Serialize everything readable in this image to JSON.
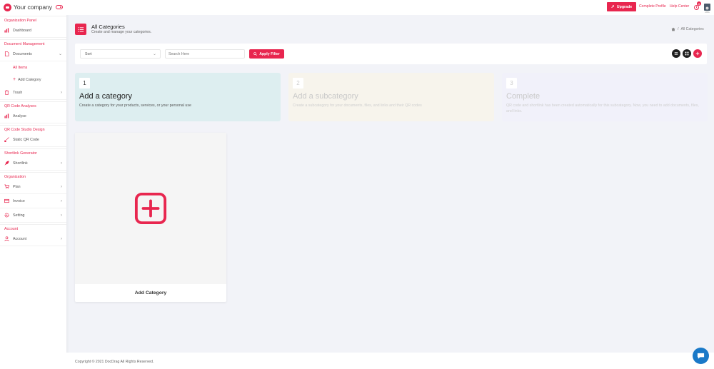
{
  "brand": {
    "name": "Your company"
  },
  "sidebar": {
    "sections": {
      "org_panel": "Organization Panel",
      "doc_mgmt": "Document Management",
      "qr_analyses": "QR Code Analyses",
      "qr_studio": "QR Code Studio Design",
      "shortlink_gen": "Shortlink Generator",
      "organization": "Organization",
      "account": "Account"
    },
    "items": {
      "dashboard": "Dashboard",
      "documents": "Documents",
      "all_items": "All Items",
      "add_category": "Add Category",
      "trash": "Trash",
      "analyse": "Analyse",
      "static_qr": "Static QR Code",
      "shortlink": "Shortlink",
      "plan": "Plan",
      "invoice": "Invoice",
      "setting": "Setting",
      "account": "Account"
    }
  },
  "header": {
    "upgrade_label": "Upgrade",
    "complete_profile": "Complete Profile",
    "help_center": "Help Center",
    "notification_count": "8"
  },
  "page": {
    "title": "All Categories",
    "subtitle": "Create and manage your categories.",
    "breadcrumb_current": "All Categories",
    "breadcrumb_sep": "/"
  },
  "filter": {
    "sort_label": "Sort",
    "search_placeholder": "Search Here",
    "apply_label": "Apply Filter"
  },
  "steps": [
    {
      "num": "1",
      "title": "Add a category",
      "desc": "Create a category for your products, services, or your personal use"
    },
    {
      "num": "2",
      "title": "Add a subcategory",
      "desc": "Create a subcategory for your documents, files, and links and their QR codes"
    },
    {
      "num": "3",
      "title": "Complete",
      "desc": "QR code and shortlink has been created automatically for this subcategory. Now, you need to add documents, files, and links."
    }
  ],
  "add_card": {
    "label": "Add Category"
  },
  "footer": {
    "copyright": "Copyright © 2021 DocDrag All Rights Reserved."
  },
  "colors": {
    "accent": "#e8264f",
    "chat": "#1a79c8"
  }
}
